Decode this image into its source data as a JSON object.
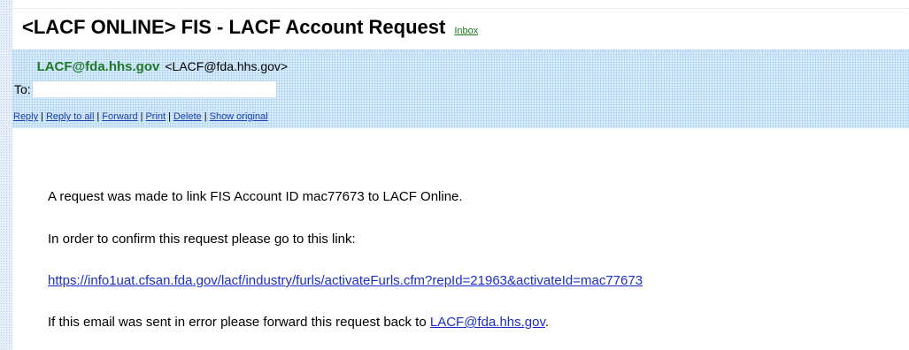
{
  "email": {
    "subject": "<LACF ONLINE> FIS - LACF Account Request",
    "label": "Inbox",
    "from_name": "LACF@fda.hhs.gov",
    "from_address": "<LACF@fda.hhs.gov>",
    "to_label": "To:",
    "to_value": "",
    "actions": [
      "Reply",
      "Reply to all",
      "Forward",
      "Print",
      "Delete",
      "Show original"
    ],
    "separator": "|"
  },
  "body": {
    "line1": "A  request was made to link FIS Account ID mac77673 to LACF Online.",
    "line2": "In order to confirm this request please go to this link:",
    "link_url": "https://info1uat.cfsan.fda.gov/lacf/industry/furls/activateFurls.cfm?repId=21963&activateId=mac77673",
    "line4_prefix": "If this email was sent in error please forward this request back to ",
    "line4_link": "LACF@fda.hhs.gov",
    "line4_suffix": "."
  },
  "colors": {
    "header_background": "#d9ecfb",
    "sender_green": "#1f7a28",
    "link_blue": "#1a2fc9"
  }
}
